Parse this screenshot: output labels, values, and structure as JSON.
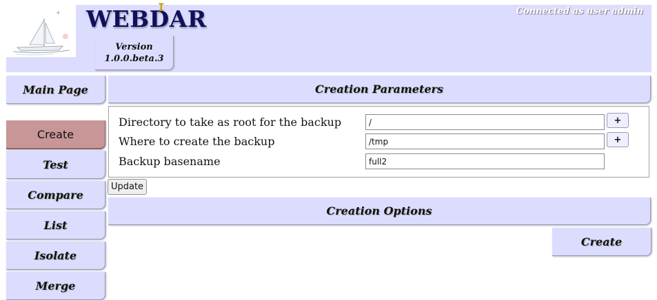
{
  "header": {
    "title": "WEBDAR",
    "version_line1": "Version",
    "version_line2": "1.0.0.beta.3",
    "connected": "Connected as user admin"
  },
  "nav": {
    "main_page": "Main Page",
    "items": [
      "Create",
      "Test",
      "Compare",
      "List",
      "Isolate",
      "Merge"
    ],
    "active": "Create"
  },
  "creation_parameters": {
    "title": "Creation Parameters",
    "fields": [
      {
        "label": "Directory to take as root for the backup",
        "value": "/"
      },
      {
        "label": "Where to create the backup",
        "value": "/tmp"
      },
      {
        "label": "Backup basename",
        "value": "full2"
      }
    ],
    "plus_label": "+",
    "update_label": "Update"
  },
  "creation_options": {
    "title": "Creation Options"
  },
  "action": {
    "create_label": "Create"
  },
  "colors": {
    "panel_bg": "#dcdcff",
    "active_nav_bg": "#c89696",
    "title_color": "#10105e"
  }
}
